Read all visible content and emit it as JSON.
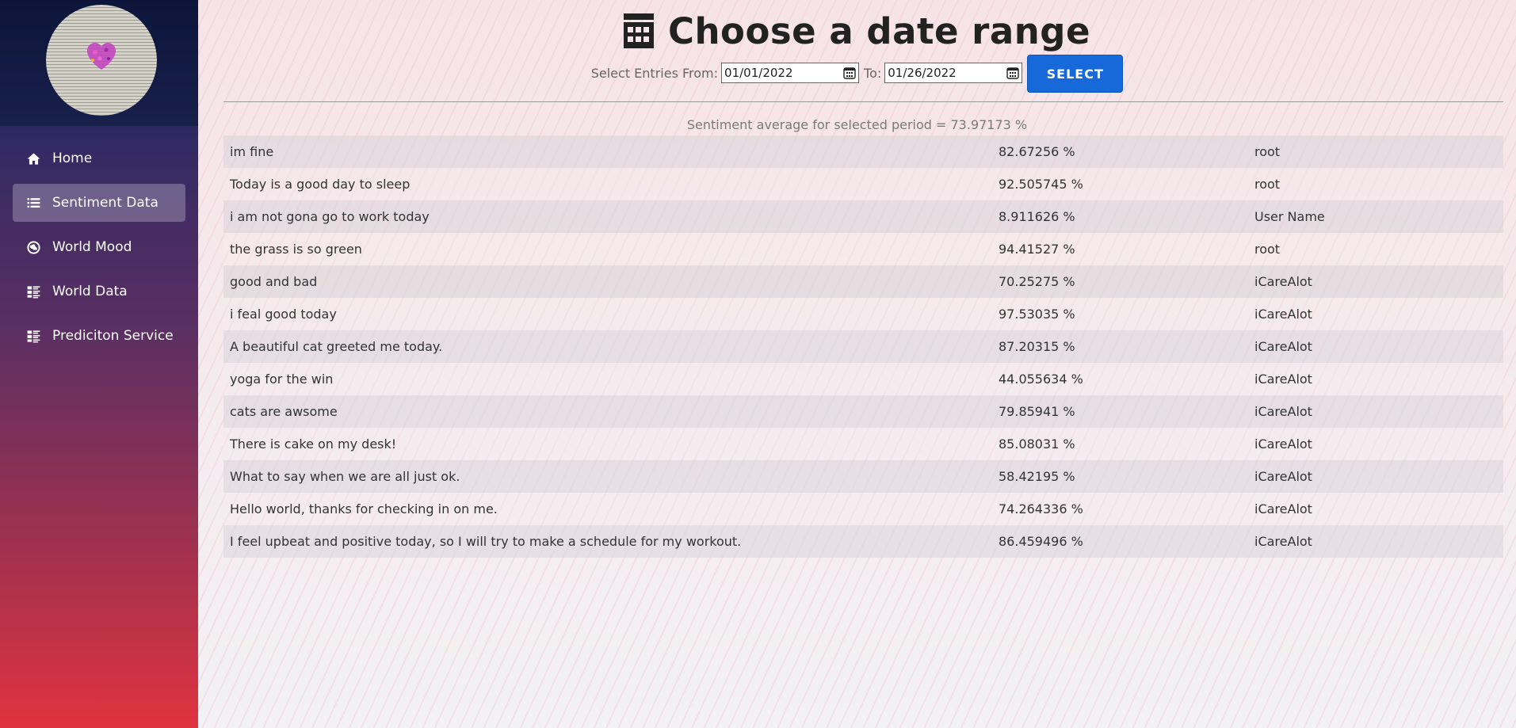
{
  "sidebar": {
    "items": [
      {
        "label": "Home",
        "icon": "home-icon",
        "active": false
      },
      {
        "label": "Sentiment Data",
        "icon": "list-icon",
        "active": true
      },
      {
        "label": "World Mood",
        "icon": "globe-icon",
        "active": false
      },
      {
        "label": "World Data",
        "icon": "grid-list-icon",
        "active": false
      },
      {
        "label": "Prediciton Service",
        "icon": "grid-list-icon",
        "active": false
      }
    ]
  },
  "header": {
    "title": "Choose a date range",
    "from_label": "Select Entries From:",
    "from_value": "01/01/2022",
    "to_label": "To:",
    "to_value": "01/26/2022",
    "select_label": "SELECT"
  },
  "summary": {
    "average_text": "Sentiment average for selected period = 73.97173 %"
  },
  "table": {
    "rows": [
      {
        "text": "im fine",
        "score": "82.67256 %",
        "user": "root"
      },
      {
        "text": "Today is a good day to sleep",
        "score": "92.505745 %",
        "user": "root"
      },
      {
        "text": "i am not gona go to work today",
        "score": "8.911626 %",
        "user": "User Name"
      },
      {
        "text": "the grass is so green",
        "score": "94.41527 %",
        "user": "root"
      },
      {
        "text": "good and bad",
        "score": "70.25275 %",
        "user": "iCareAlot"
      },
      {
        "text": "i feal good today",
        "score": "97.53035 %",
        "user": "iCareAlot"
      },
      {
        "text": "A beautiful cat greeted me today.",
        "score": "87.20315 %",
        "user": "iCareAlot"
      },
      {
        "text": "yoga for the win",
        "score": "44.055634 %",
        "user": "iCareAlot"
      },
      {
        "text": "cats are awsome",
        "score": "79.85941 %",
        "user": "iCareAlot"
      },
      {
        "text": "There is cake on my desk!",
        "score": "85.08031 %",
        "user": "iCareAlot"
      },
      {
        "text": "What to say when we are all just ok.",
        "score": "58.42195 %",
        "user": "iCareAlot"
      },
      {
        "text": "Hello world, thanks for checking in on me.",
        "score": "74.264336 %",
        "user": "iCareAlot"
      },
      {
        "text": "I feel upbeat and positive today, so I will try to make a schedule for my workout.",
        "score": "86.459496 %",
        "user": "iCareAlot"
      }
    ]
  },
  "colors": {
    "accent": "#1769d9",
    "sidebar_top": "#101a44",
    "sidebar_bottom": "#e0333f"
  }
}
